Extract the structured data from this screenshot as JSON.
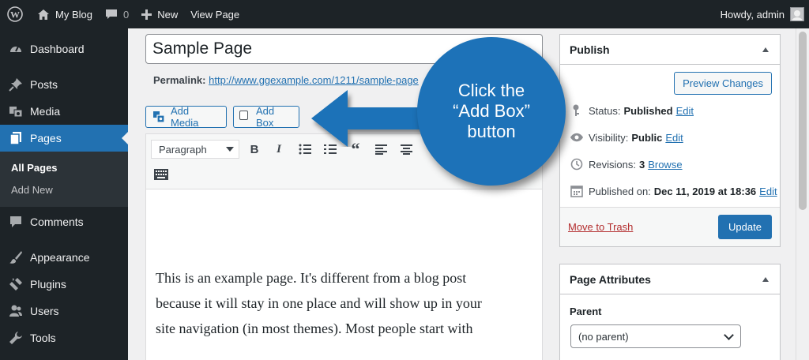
{
  "adminbar": {
    "site_name": "My Blog",
    "comments_count": "0",
    "new_label": "New",
    "view_page_label": "View Page",
    "howdy": "Howdy, admin"
  },
  "sidebar": {
    "items": [
      {
        "label": "Dashboard",
        "icon": "dashboard-icon"
      },
      {
        "label": "Posts",
        "icon": "pin-icon"
      },
      {
        "label": "Media",
        "icon": "media-icon"
      },
      {
        "label": "Pages",
        "icon": "pages-icon"
      },
      {
        "label": "Comments",
        "icon": "comment-icon"
      },
      {
        "label": "Appearance",
        "icon": "brush-icon"
      },
      {
        "label": "Plugins",
        "icon": "plugin-icon"
      },
      {
        "label": "Users",
        "icon": "users-icon"
      },
      {
        "label": "Tools",
        "icon": "wrench-icon"
      }
    ],
    "submenu": [
      "All Pages",
      "Add New"
    ]
  },
  "editor": {
    "title": "Sample Page",
    "permalink_label": "Permalink:",
    "permalink_url": "http://www.ggexample.com/1211/sample-page",
    "add_media_label": "Add Media",
    "add_box_label": "Add Box",
    "format_value": "Paragraph",
    "content_lines": [
      "This is an example page. It's different from a blog post",
      "because it will stay in one place and will show up in your",
      "site navigation (in most themes). Most people start with"
    ]
  },
  "publish": {
    "title": "Publish",
    "preview_label": "Preview Changes",
    "status_label": "Status:",
    "status_value": "Published",
    "visibility_label": "Visibility:",
    "visibility_value": "Public",
    "revisions_label": "Revisions:",
    "revisions_value": "3",
    "browse_label": "Browse",
    "published_on_label": "Published on:",
    "published_on_value": "Dec 11, 2019 at 18:36",
    "edit_label": "Edit",
    "trash_label": "Move to Trash",
    "update_label": "Update"
  },
  "attributes": {
    "title": "Page Attributes",
    "parent_label": "Parent",
    "parent_value": "(no parent)"
  },
  "callout": {
    "line1": "Click the",
    "line2": "“Add Box”",
    "line3": "button"
  },
  "colors": {
    "accent": "#2271b1",
    "adminbar": "#1d2327",
    "callout": "#1d72b8"
  }
}
